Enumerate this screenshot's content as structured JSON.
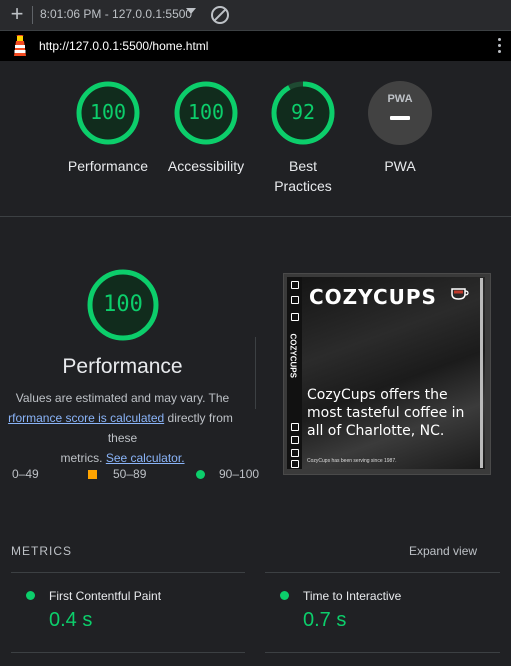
{
  "toolbar": {
    "session": "8:01:06 PM - 127.0.0.1:5500"
  },
  "urlbar": {
    "url": "http://127.0.0.1:5500/home.html"
  },
  "gauges": [
    {
      "score": "100",
      "label": "Performance",
      "fraction": 1.0
    },
    {
      "score": "100",
      "label": "Accessibility",
      "fraction": 1.0
    },
    {
      "score": "92",
      "label": "Best Practices",
      "fraction": 0.92
    },
    {
      "score": "PWA",
      "label": "PWA",
      "fraction": 0
    }
  ],
  "performance": {
    "score": "100",
    "title": "Performance",
    "desc_line1": "Values are estimated and may vary. The",
    "desc_link1": "rformance score is calculated",
    "desc_mid": " directly from these",
    "desc_line3_pre": "metrics. ",
    "desc_link2": "See calculator."
  },
  "legend": {
    "fail": "0–49",
    "average": "50–89",
    "pass": "90–100"
  },
  "thumbnail": {
    "brand": "COZYCUPS",
    "sideword": "COZYCUPS",
    "headline": "CozyCups offers the most tasteful coffee in all of Charlotte, NC.",
    "small": "CozyCups has been serving since 1987."
  },
  "metrics": {
    "label": "METRICS",
    "expand": "Expand view",
    "items": [
      {
        "name": "First Contentful Paint",
        "value": "0.4 s"
      },
      {
        "name": "Time to Interactive",
        "value": "0.7 s"
      }
    ]
  },
  "colors": {
    "pass": "#0cce6b",
    "average": "#ffa400",
    "link": "#8ab4f8",
    "background": "#202124"
  }
}
